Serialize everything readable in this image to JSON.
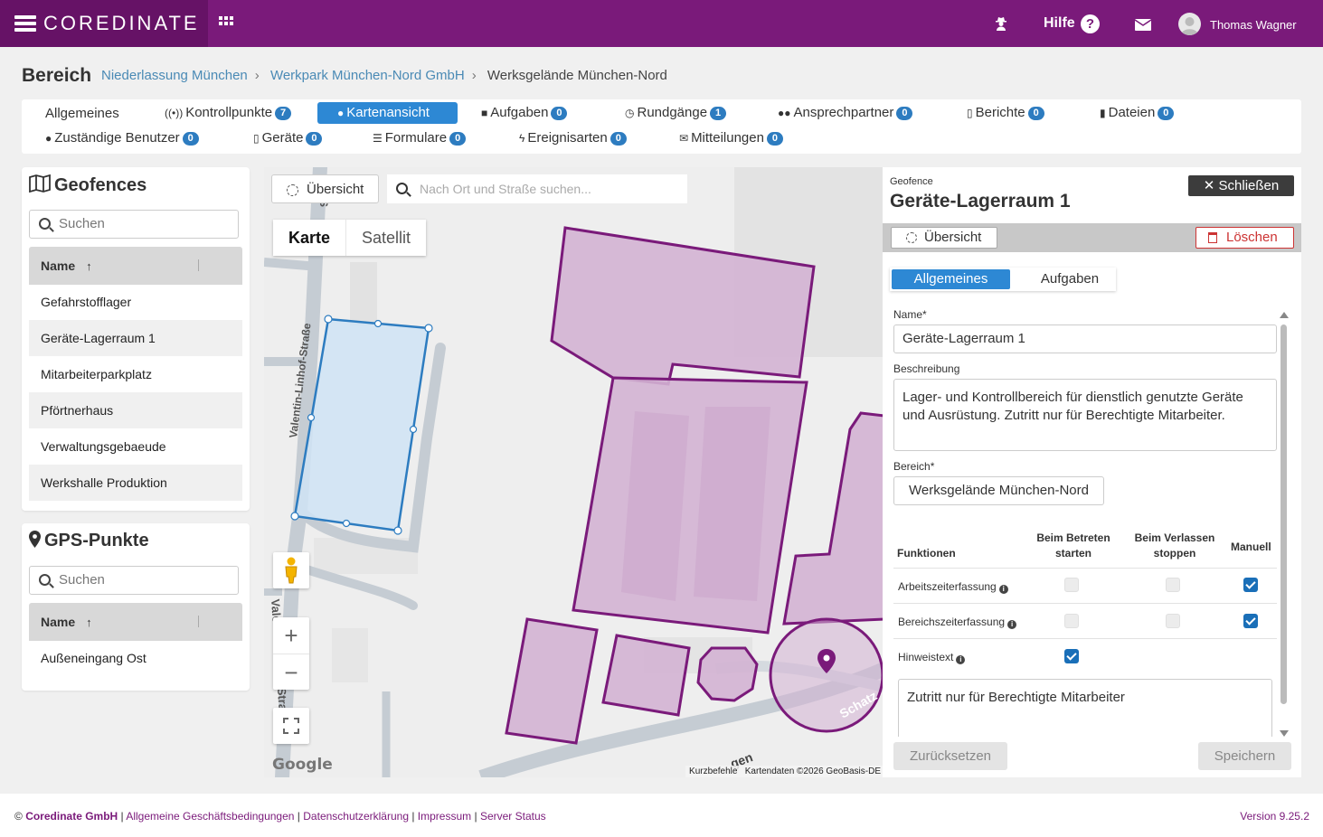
{
  "app": {
    "brand": "COREDINATE",
    "help_label": "Hilfe",
    "user_name": "Thomas Wagner"
  },
  "header": {
    "title": "Bereich",
    "breadcrumbs": [
      "Niederlassung München",
      "Werkpark München-Nord GmbH",
      "Werksgelände München-Nord"
    ]
  },
  "tabs": [
    {
      "label": "Allgemeines",
      "badge": null,
      "icon": "none"
    },
    {
      "label": "Kontrollpunkte",
      "badge": "7",
      "icon": "rfid-icon"
    },
    {
      "label": "Kartenansicht",
      "badge": null,
      "icon": "map-marker-icon",
      "active": true
    },
    {
      "label": "Aufgaben",
      "badge": "0",
      "icon": "briefcase-icon"
    },
    {
      "label": "Rundgänge",
      "badge": "1",
      "icon": "compass-icon"
    },
    {
      "label": "Ansprechpartner",
      "badge": "0",
      "icon": "users-icon"
    },
    {
      "label": "Berichte",
      "badge": "0",
      "icon": "file-icon"
    },
    {
      "label": "Dateien",
      "badge": "0",
      "icon": "files-icon"
    },
    {
      "label": "Zuständige Benutzer",
      "badge": "0",
      "icon": "user-icon"
    },
    {
      "label": "Geräte",
      "badge": "0",
      "icon": "mobile-icon"
    },
    {
      "label": "Formulare",
      "badge": "0",
      "icon": "list-icon"
    },
    {
      "label": "Ereignisarten",
      "badge": "0",
      "icon": "bolt-icon"
    },
    {
      "label": "Mitteilungen",
      "badge": "0",
      "icon": "envelope-icon"
    }
  ],
  "geofences": {
    "title": "Geofences",
    "search_placeholder": "Suchen",
    "column": "Name",
    "items": [
      "Gefahrstofflager",
      "Geräte-Lagerraum 1",
      "Mitarbeiterparkplatz",
      "Pförtnerhaus",
      "Verwaltungsgebaeude",
      "Werkshalle Produktion"
    ]
  },
  "gps": {
    "title": "GPS-Punkte",
    "search_placeholder": "Suchen",
    "column": "Name",
    "items": [
      "Außeneingang Ost"
    ]
  },
  "map": {
    "overview_label": "Übersicht",
    "search_placeholder": "Nach Ort und Straße suchen...",
    "type_map": "Karte",
    "type_satellite": "Satellit",
    "street_1": "Valentin-Linhof-Straße",
    "street_2": "Valentin-Linhof-Straße",
    "street_3": "Schatz",
    "street_4": "gen",
    "google": "Google",
    "attr_shortcuts": "Kurzbefehle",
    "attr_data": "Kartendaten ©2026 GeoBasis-DE",
    "colors": {
      "geofence": "#7a1a7a",
      "selected": "#2d88d4"
    }
  },
  "detail": {
    "kicker": "Geofence",
    "title": "Geräte-Lagerraum 1",
    "close_label": "Schließen",
    "overview_label": "Übersicht",
    "delete_label": "Löschen",
    "tab_general": "Allgemeines",
    "tab_tasks": "Aufgaben",
    "name_label": "Name*",
    "name_value": "Geräte-Lagerraum 1",
    "desc_label": "Beschreibung",
    "desc_value": "Lager- und Kontrollbereich für dienstlich genutzte Geräte und Ausrüstung. Zutritt nur für Berechtigte Mitarbeiter.",
    "area_label": "Bereich*",
    "area_value": "Werksgelände München-Nord",
    "fn_head": "Funktionen",
    "col_enter": "Beim Betreten starten",
    "col_leave": "Beim Verlassen stoppen",
    "col_manual": "Manuell",
    "functions": [
      {
        "label": "Arbeitszeiterfassung",
        "enter": false,
        "leave": false,
        "manual": true
      },
      {
        "label": "Bereichszeiterfassung",
        "enter": false,
        "leave": false,
        "manual": true
      },
      {
        "label": "Hinweistext",
        "enter": true,
        "leave": null,
        "manual": null
      }
    ],
    "hint_text": "Zutritt nur für Berechtigte Mitarbeiter",
    "reset_label": "Zurücksetzen",
    "save_label": "Speichern"
  },
  "footer": {
    "company": "Coredinate GmbH",
    "links": [
      "Allgemeine Geschäftsbedingungen",
      "Datenschutzerklärung",
      "Impressum",
      "Server Status"
    ],
    "version": "Version 9.25.2"
  }
}
